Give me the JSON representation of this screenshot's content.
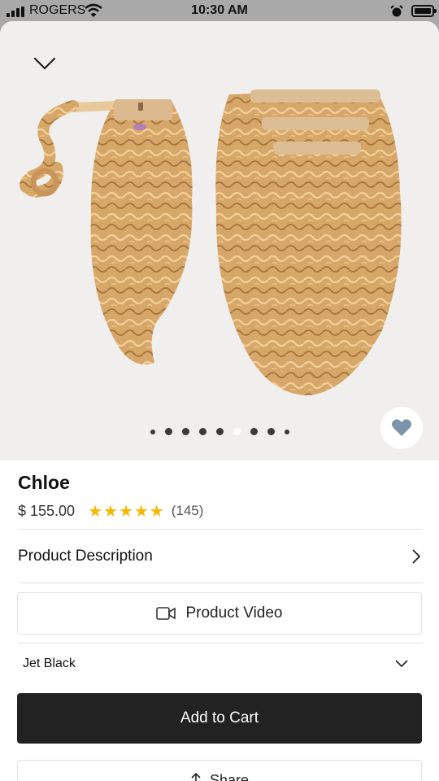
{
  "status_bar": {
    "carrier": "ROGERS",
    "time": "10:30 AM"
  },
  "product": {
    "name": "Chloe",
    "price": "$ 155.00",
    "rating": 5,
    "stars_text": "★★★★★",
    "review_count": "(145)"
  },
  "gallery": {
    "image_count": 9,
    "active_index": 5
  },
  "sections": {
    "description_label": "Product Description",
    "video_label": "Product Video"
  },
  "color_select": {
    "selected": "Jet Black"
  },
  "actions": {
    "add_to_cart": "Add to Cart",
    "share": "Share"
  },
  "colors": {
    "hair": "#d9a86a",
    "button_dark": "#222222",
    "star": "#f5b800",
    "heart": "#7d93aa"
  },
  "icons": [
    "chevron-down-icon",
    "heart-icon",
    "chevron-right-icon",
    "video-camera-icon",
    "share-icon"
  ]
}
